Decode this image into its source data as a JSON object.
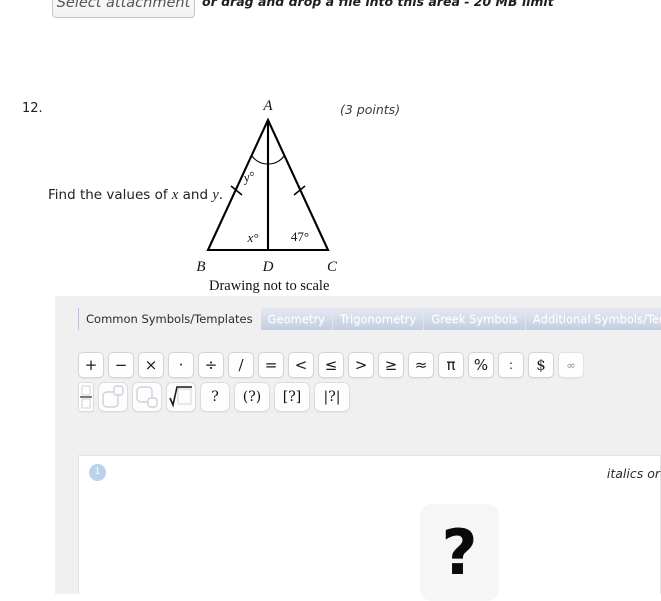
{
  "attachment": {
    "button_label": "Select attachment",
    "hint": "or drag and drop a file into this area - 20 MB limit"
  },
  "question": {
    "number": "12.",
    "points": "(3 points)",
    "prompt_prefix": "Find the values of ",
    "prompt_var1": "x",
    "prompt_mid": " and ",
    "prompt_var2": "y",
    "prompt_suffix": ".",
    "caption": "Drawing not to scale"
  },
  "figure": {
    "type": "isosceles-triangle-with-altitude",
    "vertex_labels": {
      "apex": "A",
      "bottom_left": "B",
      "bottom_mid": "D",
      "bottom_right": "C"
    },
    "angle_labels": {
      "apex_left": "y°",
      "at_d_left": "x°",
      "at_c": "47°"
    },
    "tick_marks": "congruent sides AB and AC",
    "stroke_color": "#000000"
  },
  "editor": {
    "tabs": [
      {
        "label": "Common Symbols/Templates",
        "active": true
      },
      {
        "label": "Geometry",
        "active": false
      },
      {
        "label": "Trigonometry",
        "active": false
      },
      {
        "label": "Greek Symbols",
        "active": false
      },
      {
        "label": "Additional Symbols/Templates",
        "active": false
      }
    ],
    "symbol_row_1": [
      {
        "glyph": "+",
        "name": "plus"
      },
      {
        "glyph": "−",
        "name": "minus"
      },
      {
        "glyph": "×",
        "name": "multiply"
      },
      {
        "glyph": "·",
        "name": "dot-multiply"
      },
      {
        "glyph": "÷",
        "name": "divide"
      },
      {
        "glyph": "/",
        "name": "slash"
      },
      {
        "glyph": "=",
        "name": "equals"
      },
      {
        "glyph": "<",
        "name": "less-than"
      },
      {
        "glyph": "≤",
        "name": "less-than-or-equal"
      },
      {
        "glyph": ">",
        "name": "greater-than"
      },
      {
        "glyph": "≥",
        "name": "greater-than-or-equal"
      },
      {
        "glyph": "≈",
        "name": "approximately-equal"
      },
      {
        "glyph": "π",
        "name": "pi"
      },
      {
        "glyph": "%",
        "name": "percent"
      },
      {
        "glyph": ":",
        "name": "colon-ratio"
      },
      {
        "glyph": "$",
        "name": "dollar"
      },
      {
        "glyph": "∞",
        "name": "infinity"
      }
    ],
    "symbol_row_2_templates": [
      {
        "name": "fraction",
        "glyph": ""
      },
      {
        "name": "superscript",
        "glyph": ""
      },
      {
        "name": "subscript",
        "glyph": ""
      },
      {
        "name": "square-root",
        "glyph": ""
      },
      {
        "name": "placeholder",
        "glyph": "?"
      },
      {
        "name": "parentheses",
        "glyph": "(?)"
      },
      {
        "name": "brackets",
        "glyph": "[?]"
      },
      {
        "name": "absolute-value",
        "glyph": "|?|"
      }
    ],
    "answer": {
      "index_badge": "1",
      "hint": "italics or",
      "placeholder_glyph": "?"
    }
  },
  "colors": {
    "panel_background": "#f0f0f0",
    "tab_active_text": "#2a2a2a",
    "tab_inactive_text": "#ffffff",
    "badge_background": "#b8d3ea",
    "answer_background": "#ffffff"
  }
}
